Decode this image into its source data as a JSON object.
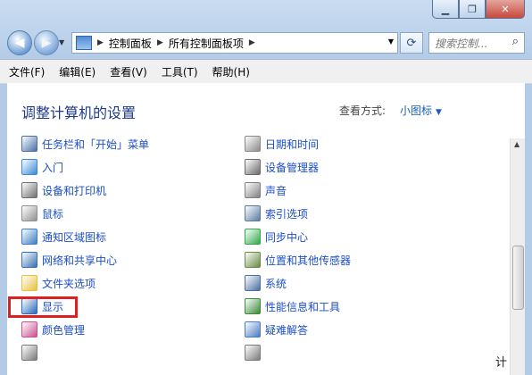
{
  "window": {
    "caption_buttons": [
      "▁",
      "❐",
      "✕"
    ]
  },
  "nav": {
    "breadcrumbs": [
      "控制面板",
      "所有控制面板项"
    ],
    "search_placeholder": "搜索控制...",
    "refresh_glyph": "⟳",
    "search_glyph": "⌕"
  },
  "menu": [
    "文件(F)",
    "编辑(E)",
    "查看(V)",
    "工具(T)",
    "帮助(H)"
  ],
  "header": {
    "title": "调整计算机的设置",
    "view_by_label": "查看方式:",
    "view_by_value": "小图标"
  },
  "left_items": [
    {
      "label": "任务栏和「开始」菜单",
      "icon": "taskbar-icon",
      "color": "#4a6fa5"
    },
    {
      "label": "入门",
      "icon": "getting-started-icon",
      "color": "#3a8ad4"
    },
    {
      "label": "设备和打印机",
      "icon": "printer-icon",
      "color": "#707070"
    },
    {
      "label": "鼠标",
      "icon": "mouse-icon",
      "color": "#909090"
    },
    {
      "label": "通知区域图标",
      "icon": "notification-icon",
      "color": "#3a7fc0"
    },
    {
      "label": "网络和共享中心",
      "icon": "network-icon",
      "color": "#3a6fb0"
    },
    {
      "label": "文件夹选项",
      "icon": "folder-icon",
      "color": "#e8c040"
    },
    {
      "label": "显示",
      "icon": "display-icon",
      "color": "#2a6ab8"
    },
    {
      "label": "颜色管理",
      "icon": "color-management-icon",
      "color": "#c85090"
    },
    {
      "label": "",
      "icon": "partial-icon",
      "color": "#7a7a7a"
    }
  ],
  "right_items": [
    {
      "label": "日期和时间",
      "icon": "clock-icon",
      "color": "#8a8a8a"
    },
    {
      "label": "设备管理器",
      "icon": "device-manager-icon",
      "color": "#6a6a6a"
    },
    {
      "label": "声音",
      "icon": "speaker-icon",
      "color": "#808080"
    },
    {
      "label": "索引选项",
      "icon": "indexing-icon",
      "color": "#5a7aa0"
    },
    {
      "label": "同步中心",
      "icon": "sync-icon",
      "color": "#2fa84a"
    },
    {
      "label": "位置和其他传感器",
      "icon": "sensor-icon",
      "color": "#6a8a40"
    },
    {
      "label": "系统",
      "icon": "system-icon",
      "color": "#4a6fa0"
    },
    {
      "label": "性能信息和工具",
      "icon": "performance-icon",
      "color": "#3a8a3a"
    },
    {
      "label": "疑难解答",
      "icon": "troubleshoot-icon",
      "color": "#4a7ac0"
    },
    {
      "label": "",
      "icon": "partial-icon",
      "color": "#7a7a7a"
    }
  ],
  "taskbar_fragment": "计"
}
